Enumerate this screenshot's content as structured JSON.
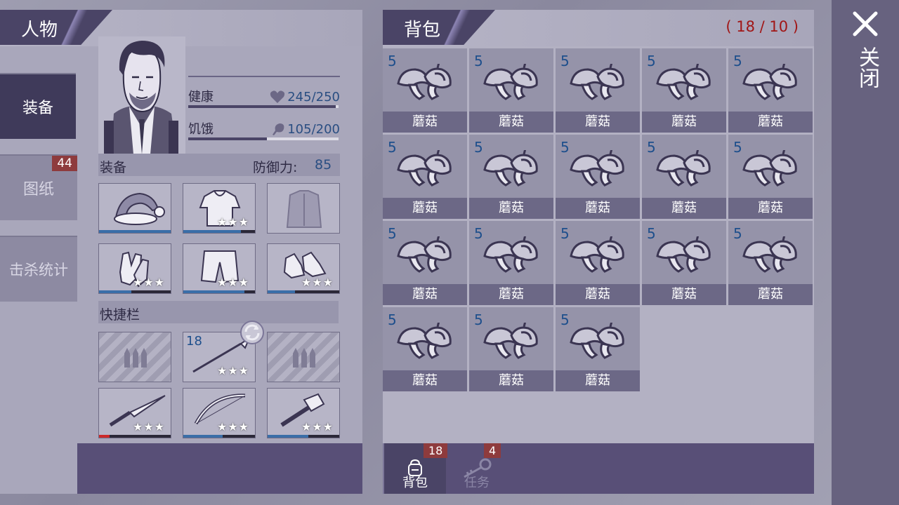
{
  "character_panel": {
    "title": "人物",
    "side_tabs": [
      {
        "label": "装备",
        "active": true,
        "badge": null
      },
      {
        "label": "图纸",
        "active": false,
        "badge": "44"
      },
      {
        "label": "击杀统计",
        "active": false,
        "badge": null
      }
    ],
    "stats": {
      "health_label": "健康",
      "health_value": "245/250",
      "health_fill": 0.98,
      "hunger_label": "饥饿",
      "hunger_value": "105/200",
      "hunger_fill": 0.525
    },
    "equipment": {
      "section_label": "装备",
      "defense_label": "防御力:",
      "defense_value": "85",
      "slots": [
        {
          "item": "santa-hat-icon",
          "stars": "",
          "durability": 1.0
        },
        {
          "item": "hooded-shirt-icon",
          "stars": "★★★",
          "durability": 0.8
        },
        {
          "item": "jacket-icon",
          "stars": "",
          "durability": 0
        },
        {
          "item": "gloves-icon",
          "stars": "★★★",
          "durability": 0.45
        },
        {
          "item": "shorts-icon",
          "stars": "★★★",
          "durability": 0.85
        },
        {
          "item": "sneakers-icon",
          "stars": "★★★",
          "durability": 0.38
        }
      ]
    },
    "quickbar": {
      "section_label": "快捷栏",
      "slots": [
        {
          "item": "ammo-placeholder-icon",
          "count": "",
          "stars": "",
          "durability": null,
          "striped": true
        },
        {
          "item": "spear-icon",
          "count": "18",
          "stars": "★★★",
          "durability": null,
          "striped": false
        },
        {
          "item": "ammo-placeholder-icon",
          "count": "",
          "stars": "",
          "durability": null,
          "striped": true
        },
        {
          "item": "knife-icon",
          "count": "",
          "stars": "★★★",
          "durability": 0.15,
          "striped": false
        },
        {
          "item": "bow-icon",
          "count": "",
          "stars": "★★★",
          "durability": 0.55,
          "striped": false
        },
        {
          "item": "hammer-icon",
          "count": "",
          "stars": "★★★",
          "durability": 0.57,
          "striped": false
        }
      ]
    }
  },
  "backpack": {
    "title": "背包",
    "capacity": "( 18 / 10 )",
    "items": [
      {
        "name": "蘑菇",
        "qty": "5"
      },
      {
        "name": "蘑菇",
        "qty": "5"
      },
      {
        "name": "蘑菇",
        "qty": "5"
      },
      {
        "name": "蘑菇",
        "qty": "5"
      },
      {
        "name": "蘑菇",
        "qty": "5"
      },
      {
        "name": "蘑菇",
        "qty": "5"
      },
      {
        "name": "蘑菇",
        "qty": "5"
      },
      {
        "name": "蘑菇",
        "qty": "5"
      },
      {
        "name": "蘑菇",
        "qty": "5"
      },
      {
        "name": "蘑菇",
        "qty": "5"
      },
      {
        "name": "蘑菇",
        "qty": "5"
      },
      {
        "name": "蘑菇",
        "qty": "5"
      },
      {
        "name": "蘑菇",
        "qty": "5"
      },
      {
        "name": "蘑菇",
        "qty": "5"
      },
      {
        "name": "蘑菇",
        "qty": "5"
      },
      {
        "name": "蘑菇",
        "qty": "5"
      },
      {
        "name": "蘑菇",
        "qty": "5"
      },
      {
        "name": "蘑菇",
        "qty": "5"
      }
    ],
    "footer_tabs": [
      {
        "label": "背包",
        "badge": "18",
        "icon": "backpack-icon",
        "active": true
      },
      {
        "label": "任务",
        "badge": "4",
        "icon": "key-icon",
        "active": false
      }
    ]
  },
  "close": {
    "label": "关闭",
    "icon": "close-icon"
  },
  "colors": {
    "accent_dark": "#4a4466",
    "badge_red": "#8e3b3d",
    "capacity_red": "#a11616",
    "durability_blue": "#3a6ea8"
  }
}
